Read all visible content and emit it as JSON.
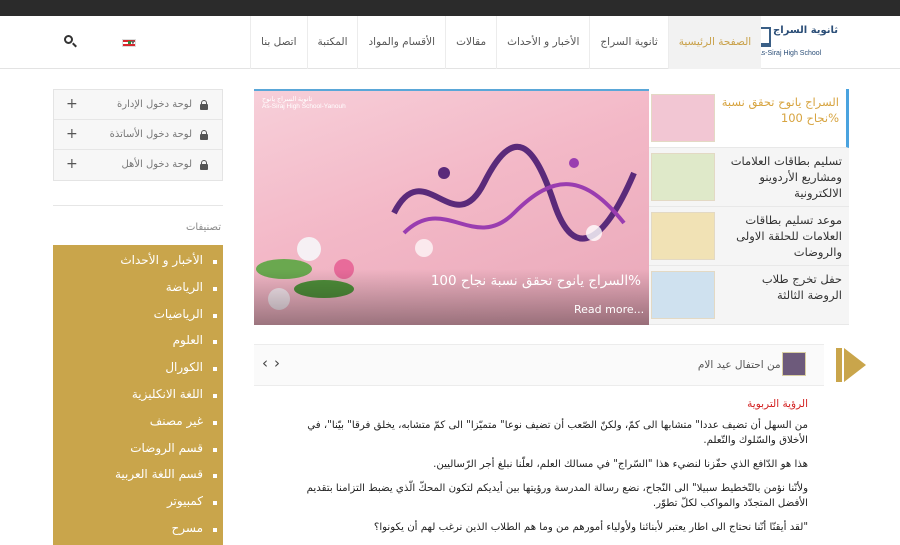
{
  "header": {
    "logo_ar": "ثانوية السراج",
    "logo_en": "As-Siraj High School",
    "nav": [
      "الصفحة الرئيسية",
      "ثانوية السراج",
      "الأخبار و الأحداث",
      "مقالات",
      "الأقسام والمواد",
      "المكتبة",
      "اتصل بنا"
    ],
    "active_nav": "الصفحة الرئيسية",
    "language_flag": "lebanon-flag-icon",
    "search_icon": "search-icon"
  },
  "sidebar": {
    "logins": [
      "لوحة دخول الإدارة",
      "لوحة دخول الأساتذة",
      "لوحة دخول الأهل"
    ],
    "categories_title": "تصنيفات",
    "categories": [
      "الأخبار و الأحداث",
      "الرياضة",
      "الرياضيات",
      "العلوم",
      "الكورال",
      "اللغة الانكليزية",
      "غير مصنف",
      "قسم الروضات",
      "قسم اللغة العربية",
      "كمبيوتر",
      "مسرح"
    ]
  },
  "slider": {
    "brand_ar": "ثانوية السراج يانوح",
    "brand_en": "As-Siraj High School-Yanouh",
    "caption": "السراج يانوح تحقق نسبة نجاح 100%",
    "read_more": "Read more..."
  },
  "side_news": [
    "السراج يانوح تحقق نسبة نجاح 100%",
    "تسليم بطاقات العلامات ومشاريع الأردوينو الالكترونية",
    "موعد تسليم بطاقات العلامات للحلقة الاولى والروضات",
    "حفل تخرج طلاب الروضة الثالثة"
  ],
  "ticker": {
    "title": "فيديو من احتفال عيد الام"
  },
  "article": {
    "heading": "الرؤية التربوية",
    "paragraphs": [
      "من السهل أن تضيف عددا\" متشابها الى كمّ، ولكنّ الصّعب أن تضيف نوعا\" متميّزا\" الى كمّ متشابه، يخلق فرقا\" بيّنا\"، في الأخلاق والسّلوك والتّعلم.",
      "هذا هو الدّافع الذي حفّزنا لنضيء هذا \"السّراج\" في مسالك العلم، لعلّنا نبلغ أجر الرّساليين.",
      "ولأنّنا نؤمن بالتّخطيط سبيلا\" الى النّجاح، نضع رسالة المدرسة ورؤيتها بين أيديكم لتكون المحكّ الّذي يضبط التزامنا بتقديم الأفضل المتجدّد والمواكب لكلّ تطوّر.",
      "\"لقد أيقنّا أنّنا نحتاج الى اطار يعتبر لأبنائنا ولأولياء أمورهم من وما هم الطلاب الذين نرغب لهم أن يكونوا؟"
    ]
  }
}
